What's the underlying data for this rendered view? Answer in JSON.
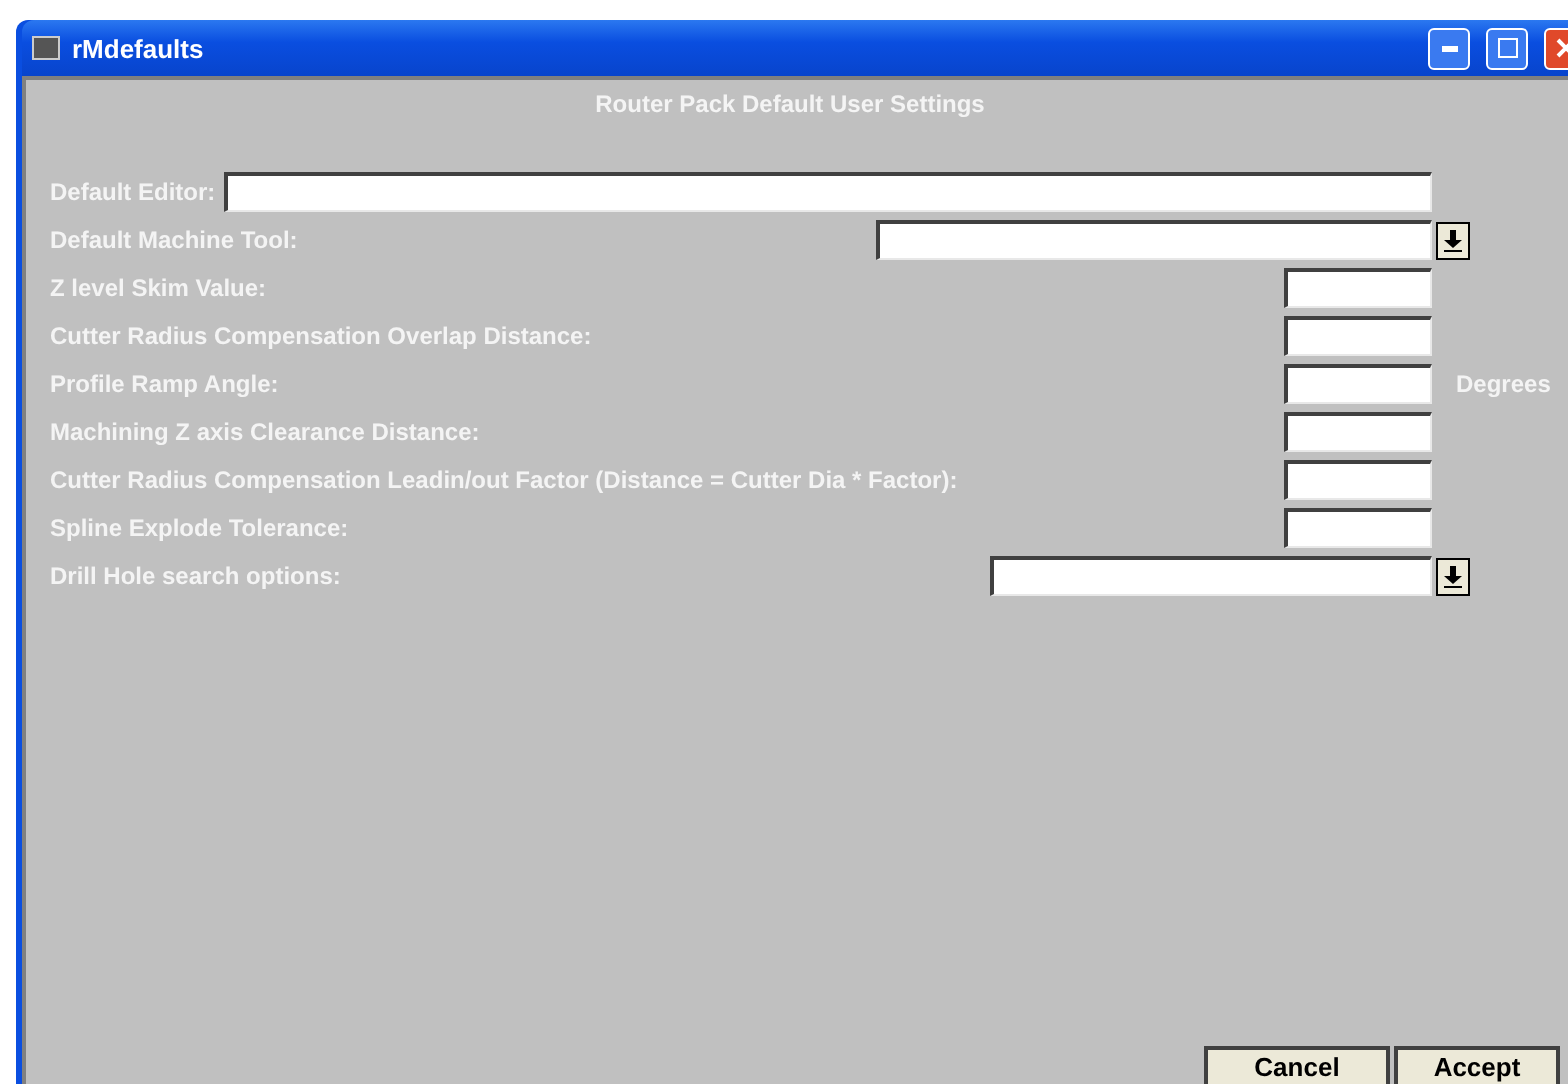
{
  "window": {
    "title": "rMdefaults"
  },
  "heading": "Router Pack Default User Settings",
  "settings": [
    {
      "label": "Default Editor:",
      "kind": "text"
    },
    {
      "label": "Default Machine Tool:",
      "kind": "dropdown"
    },
    {
      "label": "Z level Skim Value:",
      "kind": "number"
    },
    {
      "label": "Cutter Radius Compensation Overlap Distance:",
      "kind": "number"
    },
    {
      "label": "Profile Ramp Angle:",
      "kind": "number",
      "unit": "Degrees"
    },
    {
      "label": "Machining Z axis Clearance Distance:",
      "kind": "number"
    },
    {
      "label": "Cutter Radius Compensation Leadin/out Factor (Distance = Cutter Dia * Factor):",
      "kind": "number"
    },
    {
      "label": "Spline Explode Tolerance:",
      "kind": "number"
    },
    {
      "label": "Drill Hole search options:",
      "kind": "dropdown"
    }
  ],
  "buttons": [
    "Cancel",
    "Accept"
  ]
}
